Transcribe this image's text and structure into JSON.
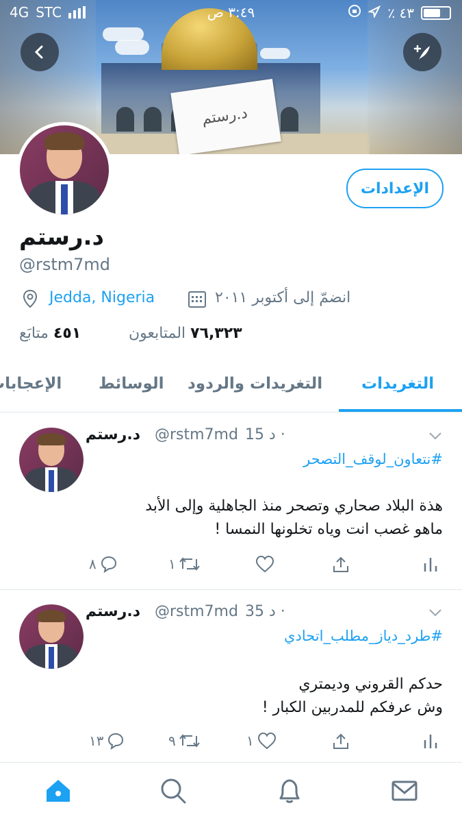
{
  "status_bar": {
    "carrier": "STC",
    "network": "4G",
    "time": "٣:٤٩ ص",
    "battery": "٪ ٤٣"
  },
  "profile": {
    "display_name": "د.رستم",
    "handle": "@rstm7md",
    "location": "Jedda, Nigeria",
    "joined": "انضمّ إلى أكتوبر ٢٠١١",
    "followers_count": "٧٦,٣٢٣",
    "followers_label": "المتابعون",
    "following_count": "٤٥١",
    "following_label": "متابَع",
    "settings_label": "الإعدادات",
    "banner_paper_text": "د.رستم"
  },
  "tabs": [
    {
      "label": "التغريدات",
      "active": true
    },
    {
      "label": "التغريدات والردود",
      "active": false
    },
    {
      "label": "الوسائط",
      "active": false
    },
    {
      "label": "الإعجابات",
      "active": false
    }
  ],
  "tweets": [
    {
      "name": "د.رستم",
      "handle": "@rstm7md",
      "time": "15 د ·",
      "hashtag": "#نتعاون_لوقف_التصحر",
      "lines": [
        "هذة البلاد صحاري وتصحر منذ الجاهلية وإلى الأبد",
        "ماهو غصب انت وياه تخلونها النمسا !"
      ],
      "replies": "٨",
      "retweets": "١",
      "likes": ""
    },
    {
      "name": "د.رستم",
      "handle": "@rstm7md",
      "time": "35 د ·",
      "hashtag": "#طرد_دياز_مطلب_اتحادي",
      "lines": [
        "حدكم القروني وديمتري",
        "وش عرفكم للمدربين الكبار !"
      ],
      "replies": "١٣",
      "retweets": "٩",
      "likes": "١"
    }
  ],
  "icons": {
    "back": "chevron-left-icon",
    "compose": "compose-icon",
    "location": "location-pin-icon",
    "calendar": "calendar-icon",
    "home": "home-icon",
    "search": "search-icon",
    "notifications": "bell-icon",
    "messages": "envelope-icon"
  },
  "colors": {
    "accent": "#1da1f2",
    "muted": "#657786",
    "text": "#14171a"
  }
}
